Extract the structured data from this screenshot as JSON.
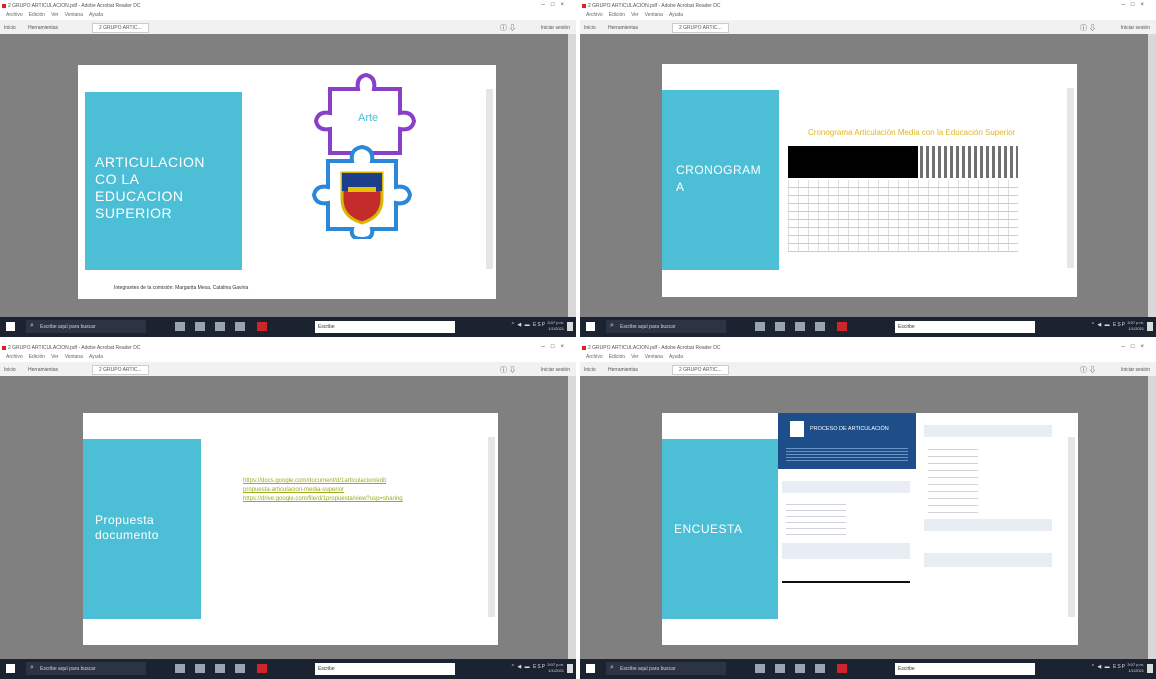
{
  "window": {
    "title": "2 GRUPO ARTICULACION.pdf - Adobe Acrobat Reader DC",
    "menu": [
      "Archivo",
      "Edición",
      "Ver",
      "Ventana",
      "Ayuda"
    ],
    "tabs": [
      "Inicio",
      "Herramientas",
      "2 GRUPO ARTIC..."
    ],
    "share_label": "Iniciar sesión"
  },
  "taskbar": {
    "search_placeholder": "Escribe aquí para buscar",
    "field_text": "Escribe",
    "sys_text": "^ ◀ ▬ ESP",
    "clock_time": "3:07 p.m.",
    "clock_date": "1/1/2021"
  },
  "slides": {
    "s1": {
      "title": "ARTICULACION\nCO LA\nEDUCACION\nSUPERIOR",
      "puzzle_label": "Arte",
      "caption": "Integrantes de la comisión: Margarita Mesa, Catalina Gaviria"
    },
    "s2": {
      "title": "CRONOGRAM\nA",
      "table_title": "Cronograma Articulación Media con la Educación Superior"
    },
    "s3": {
      "title": "Propuesta\ndocumento",
      "links": [
        "https://docs.google.com/document/d/1articulacion/edit",
        "propuesta-articulacion-media-superior",
        "https://drive.google.com/file/d/1propuesta/view?usp=sharing"
      ]
    },
    "s4": {
      "title": "ENCUESTA",
      "form_title": "PROCESO DE ARTICULACIÓN"
    }
  },
  "colors": {
    "accent_cyan": "#4cbfd6",
    "viewer_gray": "#808080",
    "link_olive": "#9aaa1e",
    "form_navy": "#1d4e89",
    "taskbar": "#1b2230"
  }
}
